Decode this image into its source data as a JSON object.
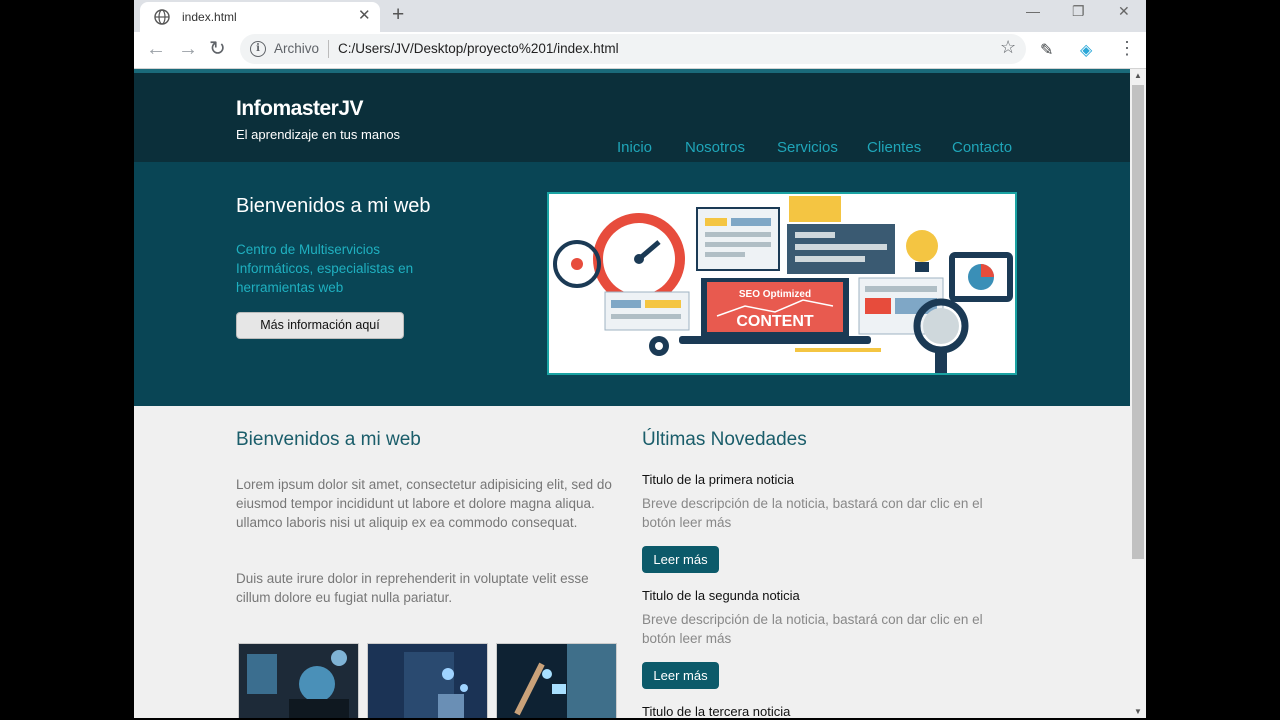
{
  "browser": {
    "tab_title": "index.html",
    "omnibox_label": "Archivo",
    "url": "C:/Users/JV/Desktop/proyecto%201/index.html"
  },
  "site": {
    "brand": "InfomasterJV",
    "tagline": "El aprendizaje en tus manos",
    "nav": [
      "Inicio",
      "Nosotros",
      "Servicios",
      "Clientes",
      "Contacto"
    ]
  },
  "hero": {
    "title": "Bienvenidos a mi web",
    "text": "Centro de Multiservicios Informáticos, especialistas en herramientas web",
    "button": "Más información aquí",
    "image_text_top": "SEO Optimized",
    "image_text_main": "CONTENT"
  },
  "left_col": {
    "title": "Bienvenidos a mi web",
    "p1": "Lorem ipsum dolor sit amet, consectetur adipisicing elit, sed do eiusmod tempor incididunt ut labore et dolore magna aliqua. ullamco laboris nisi ut aliquip ex ea commodo consequat.",
    "p2": "Duis aute irure dolor in reprehenderit in voluptate velit esse cillum dolore eu fugiat nulla pariatur."
  },
  "news": {
    "title": "Últimas Novedades",
    "items": [
      {
        "title": "Titulo de la primera noticia",
        "desc": "Breve descripción de la noticia, bastará con dar clic en el botón leer más",
        "button": "Leer más"
      },
      {
        "title": "Titulo de la segunda noticia",
        "desc": "Breve descripción de la noticia, bastará con dar clic en el botón leer más",
        "button": "Leer más"
      },
      {
        "title": "Titulo de la tercera noticia"
      }
    ]
  },
  "colors": {
    "header_bg": "#0b2f3a",
    "hero_bg": "#094555",
    "accent": "#1fa5b8",
    "button_bg": "#0c5a6a"
  },
  "icons": [
    "globe-icon",
    "close-icon",
    "plus-icon",
    "back-icon",
    "forward-icon",
    "reload-icon",
    "info-icon",
    "star-icon",
    "extension-icon",
    "menu-icon"
  ]
}
